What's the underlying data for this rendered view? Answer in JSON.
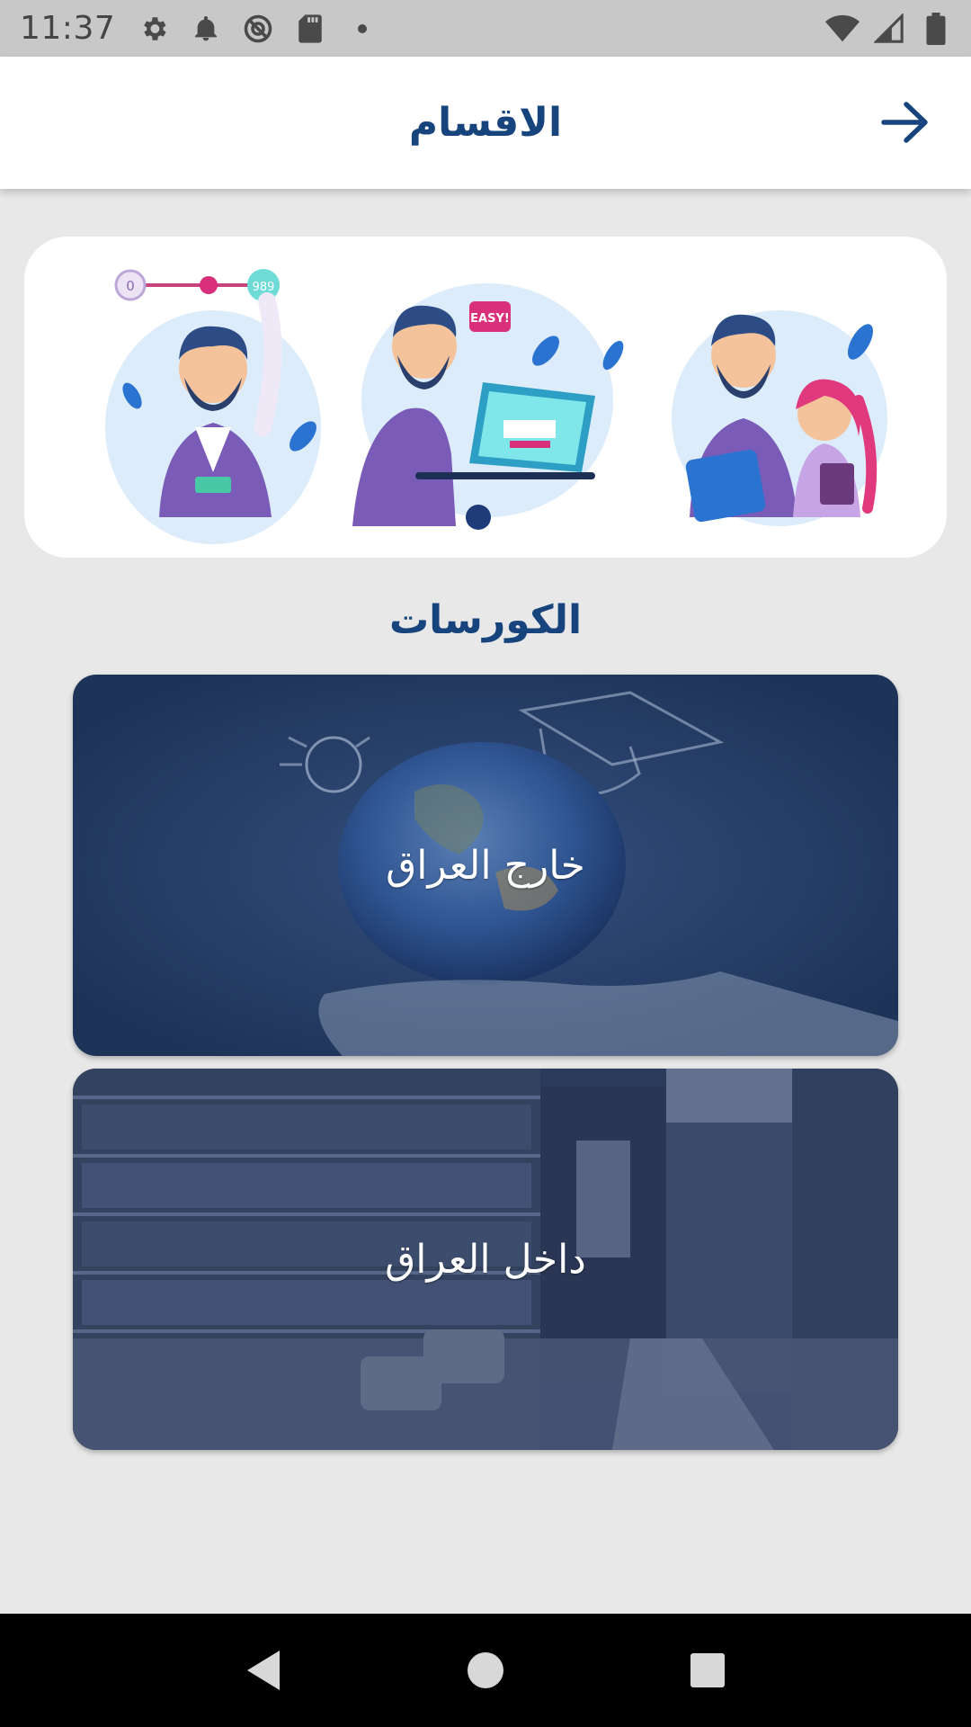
{
  "status_bar": {
    "time": "11:37",
    "left_icons": [
      "gear-icon",
      "bell-icon",
      "no-sync-icon",
      "sd-card-icon",
      "dot-icon"
    ],
    "right_icons": [
      "wifi-icon",
      "signal-icon",
      "battery-icon"
    ]
  },
  "app_bar": {
    "title": "الاقسام",
    "back_icon": "arrow-right-icon"
  },
  "banner": {
    "illustrations": [
      "teacher-with-slider-illustration",
      "teacher-at-laptop-illustration",
      "teacher-with-student-illustration"
    ],
    "slider_min": "0",
    "slider_max": "989",
    "speech_bubble": "EASY!"
  },
  "section": {
    "title": "الكورسات"
  },
  "courses": [
    {
      "label": "خارج العراق",
      "image": "globe-on-hand-chalkboard"
    },
    {
      "label": "داخل العراق",
      "image": "library-interior"
    }
  ],
  "nav_bar": {
    "buttons": [
      "back-triangle-icon",
      "home-circle-icon",
      "recents-square-icon"
    ]
  },
  "colors": {
    "accent": "#18447e",
    "card_overlay": "#1f3a66",
    "page_bg": "#e8e8e8"
  }
}
